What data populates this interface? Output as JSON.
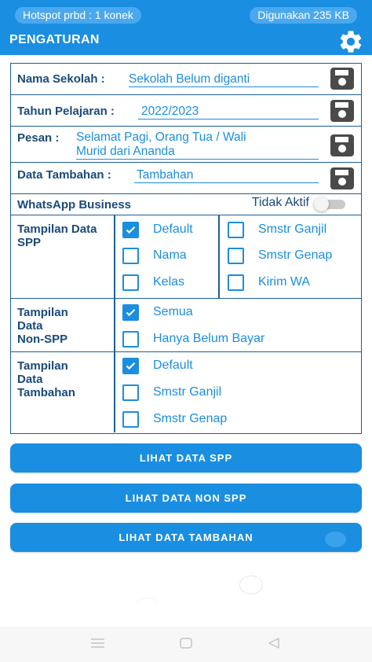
{
  "status": {
    "hotspot": "Hotspot prbd : 1 konek",
    "usage": "Digunakan 235 KB"
  },
  "appbar": {
    "title": "PENGATURAN",
    "settings_icon": "gear-icon"
  },
  "fields": {
    "school_name": {
      "label": "Nama Sekolah :",
      "value": "Sekolah Belum diganti"
    },
    "school_year": {
      "label": "Tahun Pelajaran :",
      "value": "2022/2023"
    },
    "message": {
      "label": "Pesan :",
      "line1": "Selamat Pagi, Orang Tua / Wali",
      "line2": "Murid dari Ananda"
    },
    "extra": {
      "label": "Data Tambahan :",
      "value": "Tambahan"
    },
    "save_icon": "floppy-disk-icon"
  },
  "whatsapp": {
    "label": "WhatsApp Business",
    "status": "Tidak Aktif",
    "enabled": false
  },
  "spp_display": {
    "label_line1": "Tampilan Data",
    "label_line2": "SPP",
    "options": [
      {
        "label": "Default",
        "checked": true
      },
      {
        "label": "Nama",
        "checked": false
      },
      {
        "label": "Kelas",
        "checked": false
      },
      {
        "label": "Smstr Ganjil",
        "checked": false
      },
      {
        "label": "Smstr Genap",
        "checked": false
      },
      {
        "label": "Kirim WA",
        "checked": false
      }
    ]
  },
  "nonspp_display": {
    "label_line1": "Tampilan",
    "label_line2": "Data",
    "label_line3": "Non-SPP",
    "options": [
      {
        "label": "Semua",
        "checked": true
      },
      {
        "label": "Hanya Belum Bayar",
        "checked": false
      }
    ]
  },
  "extra_display": {
    "label_line1": "Tampilan",
    "label_line2": "Data",
    "label_line3": "Tambahan",
    "options": [
      {
        "label": "Default",
        "checked": true
      },
      {
        "label": "Smstr Ganjil",
        "checked": false
      },
      {
        "label": "Smstr Genap",
        "checked": false
      }
    ]
  },
  "buttons": {
    "spp": "LIHAT DATA SPP",
    "nonspp": "LIHAT DATA NON SPP",
    "extra": "LIHAT DATA TAMBAHAN"
  },
  "colors": {
    "primary": "#1a8ee0",
    "label": "#1a4a7a",
    "border": "#1d5f94"
  }
}
